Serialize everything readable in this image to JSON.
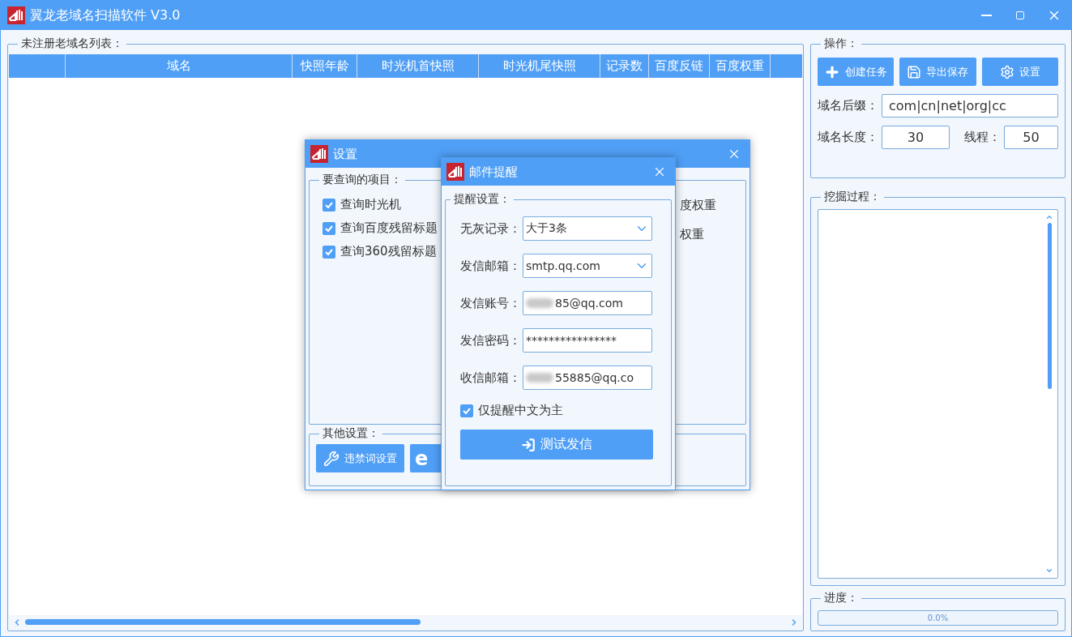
{
  "window": {
    "title": "翼龙老域名扫描软件 V3.0"
  },
  "domain_list": {
    "title": "未注册老域名列表：",
    "columns": [
      "域名",
      "快照年龄",
      "时光机首快照",
      "时光机尾快照",
      "记录数",
      "百度反链",
      "百度权重"
    ]
  },
  "operations": {
    "title": "操作：",
    "buttons": [
      {
        "label": "创建任务"
      },
      {
        "label": "导出保存"
      },
      {
        "label": "设置"
      }
    ],
    "suffix": {
      "label": "域名后缀：",
      "value": "com|cn|net|org|cc"
    },
    "length": {
      "label": "域名长度：",
      "value": "30"
    },
    "threads": {
      "label": "线程：",
      "value": "50"
    }
  },
  "process": {
    "title": "挖掘过程："
  },
  "progress": {
    "title": "进度：",
    "level": 0,
    "reading": "0.0%"
  },
  "settings_dialog": {
    "title": "设置",
    "query_group": {
      "title": "要查询的项目：",
      "items": [
        {
          "label": "查询时光机",
          "checked": true
        },
        {
          "label": "查询百度残留标题",
          "checked": true
        },
        {
          "label": "查询360残留标题",
          "checked": true
        }
      ],
      "side_items": [
        "度权重",
        "权重"
      ]
    },
    "other_group": {
      "title": "其他设置：",
      "buttons": [
        {
          "kind": "label",
          "label": "违禁词设置"
        },
        {
          "kind": "glyph",
          "glyph": "e"
        }
      ]
    }
  },
  "mail_dialog": {
    "title": "邮件提醒",
    "group_title": "提醒设置：",
    "fields": [
      {
        "kind": "select",
        "label": "无灰记录：",
        "value": "大于3条",
        "blurred": false
      },
      {
        "kind": "select",
        "label": "发信邮箱：",
        "value": "smtp.qq.com",
        "blurred": false
      },
      {
        "kind": "input",
        "label": "发信账号：",
        "value": "85@qq.com",
        "blurred": true
      },
      {
        "kind": "input",
        "label": "发信密码：",
        "value": "****************",
        "blurred": false
      },
      {
        "kind": "input",
        "label": "收信邮箱：",
        "value": "55885@qq.co",
        "blurred": true
      }
    ],
    "option": {
      "label": "仅提醒中文为主",
      "checked": true
    },
    "button": {
      "label": "测试发信"
    }
  }
}
